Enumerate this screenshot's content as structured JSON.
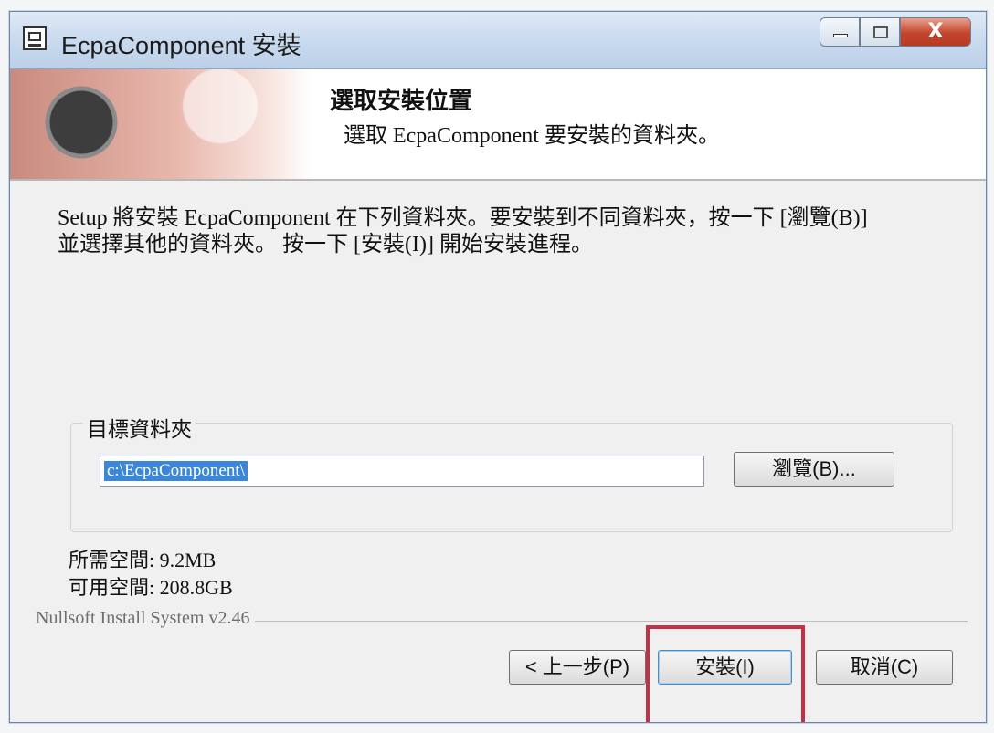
{
  "window": {
    "title": "EcpaComponent 安裝",
    "controls": {
      "minimize": "minimize-icon",
      "maximize": "maximize-icon",
      "close_glyph": "X"
    }
  },
  "header": {
    "title": "選取安裝位置",
    "subtitle": "選取 EcpaComponent 要安裝的資料夾。"
  },
  "body": {
    "description_line1": "Setup 將安裝 EcpaComponent 在下列資料夾。要安裝到不同資料夾，按一下 [瀏覽(B)]",
    "description_line2": "並選擇其他的資料夾。 按一下 [安裝(I)] 開始安裝進程。",
    "destination_group_label": "目標資料夾",
    "destination_path": "c:\\EcpaComponent\\",
    "browse_label": "瀏覽(B)...",
    "space_required": "所需空間: 9.2MB",
    "space_available": "可用空間: 208.8GB"
  },
  "footer": {
    "branding": "Nullsoft Install System v2.46",
    "back_label": "< 上一步(P)",
    "install_label": "安裝(I)",
    "cancel_label": "取消(C)"
  },
  "colors": {
    "highlight_box": "#c33148",
    "selection": "#3b86d9"
  }
}
